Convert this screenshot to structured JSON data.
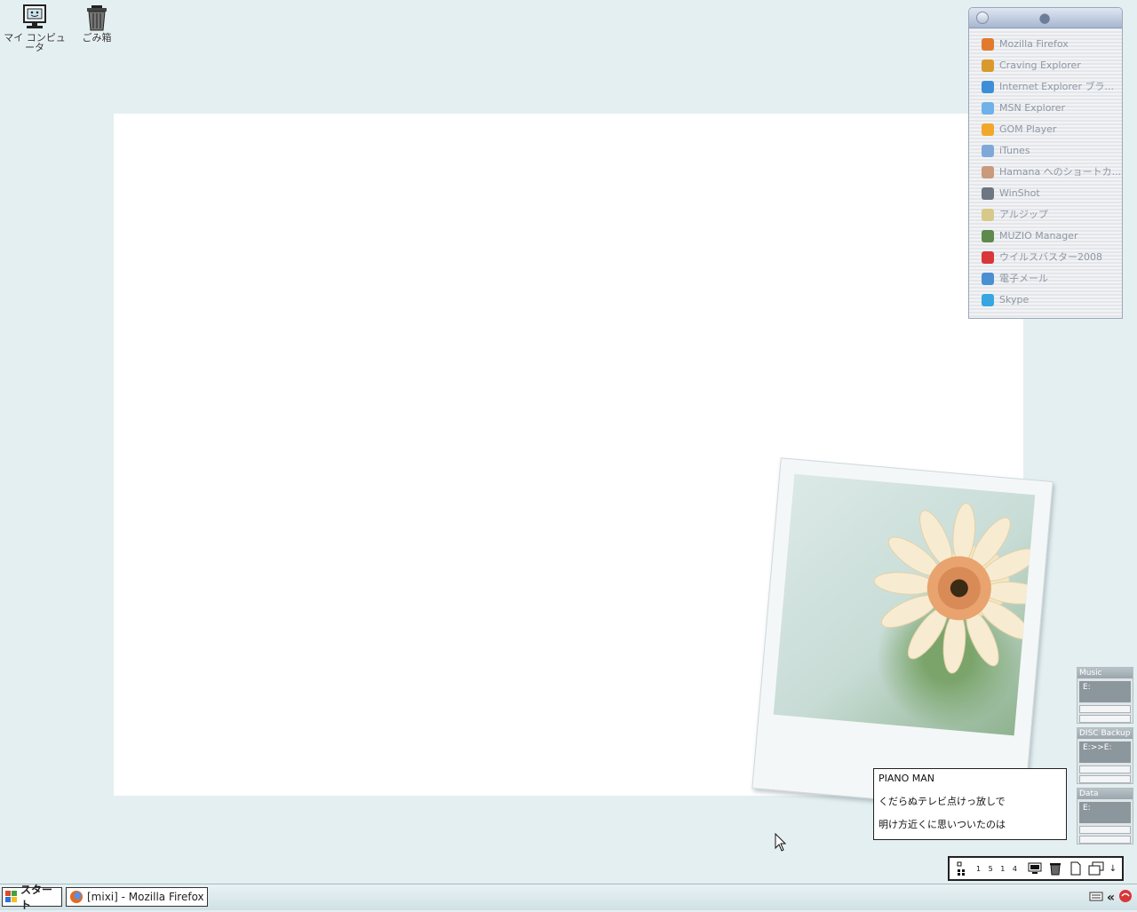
{
  "desktop": {
    "icons": [
      {
        "label": "マイ コンピュータ",
        "icon": "my-computer-icon"
      },
      {
        "label": "ごみ箱",
        "icon": "trash-icon"
      }
    ]
  },
  "launcher": {
    "title_icon": "apple-icon",
    "items": [
      {
        "label": "Mozilla Firefox",
        "color": "#e27a2e"
      },
      {
        "label": "Craving Explorer",
        "color": "#d99a2b"
      },
      {
        "label": "Internet Explorer ブラ...",
        "color": "#3c8fd6"
      },
      {
        "label": "MSN Explorer",
        "color": "#6fb1e8"
      },
      {
        "label": "GOM Player",
        "color": "#f1a82a"
      },
      {
        "label": "iTunes",
        "color": "#7fa8d8"
      },
      {
        "label": "Hamana へのショートカ...",
        "color": "#c99a7c"
      },
      {
        "label": "WinShot",
        "color": "#6d7682"
      },
      {
        "label": "アルジップ",
        "color": "#d8c98a"
      },
      {
        "label": "MUZIO Manager",
        "color": "#5e8a4e"
      },
      {
        "label": "ウイルスバスター2008",
        "color": "#d9363a"
      },
      {
        "label": "電子メール",
        "color": "#4a8fd2"
      },
      {
        "label": "Skype",
        "color": "#35a6e2"
      }
    ]
  },
  "drives": [
    {
      "title": "Music",
      "path": "E:"
    },
    {
      "title": "DISC Backup",
      "path": "E:>>E:"
    },
    {
      "title": "Data",
      "path": "E:"
    }
  ],
  "lyrics": {
    "lines": [
      "PIANO MAN",
      "くだらぬテレビ点けっ放しで",
      "明け方近くに思いついたのは"
    ]
  },
  "mini_bar": {
    "clock": "1 5 1 4"
  },
  "taskbar": {
    "start_label": "スタート",
    "window_label": "[mixi] - Mozilla Firefox",
    "tray_chevron": "«"
  }
}
